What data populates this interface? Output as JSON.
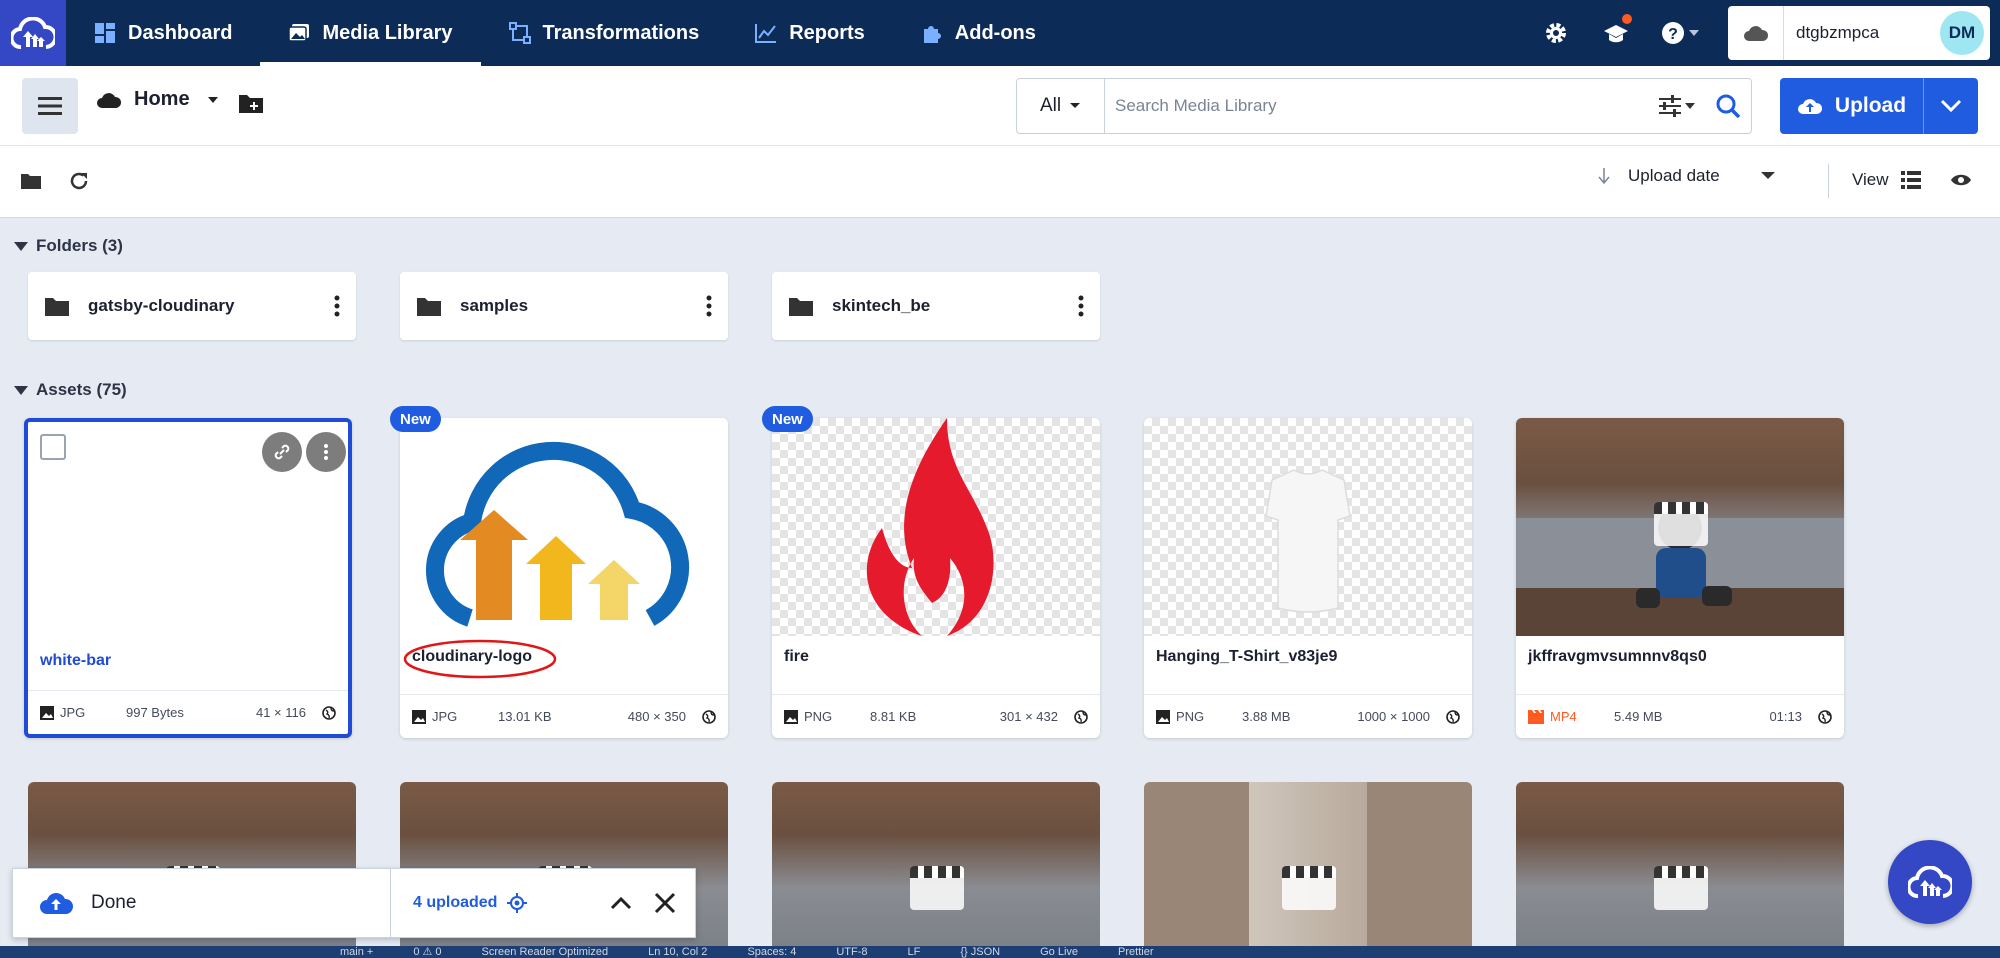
{
  "nav": {
    "items": [
      {
        "label": "Dashboard",
        "icon": "dashboard-icon"
      },
      {
        "label": "Media Library",
        "icon": "media-library-icon",
        "active": true
      },
      {
        "label": "Transformations",
        "icon": "transformations-icon"
      },
      {
        "label": "Reports",
        "icon": "reports-icon"
      },
      {
        "label": "Add-ons",
        "icon": "puzzle-icon"
      }
    ],
    "account": {
      "name": "dtgbzmpca",
      "initials": "DM"
    }
  },
  "toolbar": {
    "location": "Home",
    "search": {
      "scope": "All",
      "placeholder": "Search Media Library"
    },
    "upload_label": "Upload",
    "sort_label": "Upload date",
    "view_label": "View"
  },
  "folders": {
    "heading": "Folders (3)",
    "items": [
      {
        "name": "gatsby-cloudinary"
      },
      {
        "name": "samples"
      },
      {
        "name": "skintech_be"
      }
    ]
  },
  "assets": {
    "heading": "Assets (75)",
    "new_badge": "New",
    "items": [
      {
        "name": "white-bar",
        "type": "JPG",
        "size": "997 Bytes",
        "dims": "41 × 116"
      },
      {
        "name": "cloudinary-logo",
        "type": "JPG",
        "size": "13.01 KB",
        "dims": "480 × 350"
      },
      {
        "name": "fire",
        "type": "PNG",
        "size": "8.81 KB",
        "dims": "301 × 432"
      },
      {
        "name": "Hanging_T-Shirt_v83je9",
        "type": "PNG",
        "size": "3.88 MB",
        "dims": "1000 × 1000"
      },
      {
        "name": "jkffravgmvsumnnv8qs0",
        "type": "MP4",
        "size": "5.49 MB",
        "dims": "01:13"
      }
    ]
  },
  "toast": {
    "status": "Done",
    "summary": "4 uploaded"
  },
  "statusbar": {
    "items": [
      "main +",
      "0 ⚠ 0",
      "Screen Reader Optimized",
      "Ln 10, Col 2",
      "Spaces: 4",
      "UTF-8",
      "LF",
      "{} JSON",
      "Go Live",
      "Prettier"
    ]
  },
  "colors": {
    "nav_bg": "#0d2b57",
    "accent": "#1f5ce0",
    "logo_bg": "#3448c5",
    "video_type": "#ff5a1f"
  }
}
